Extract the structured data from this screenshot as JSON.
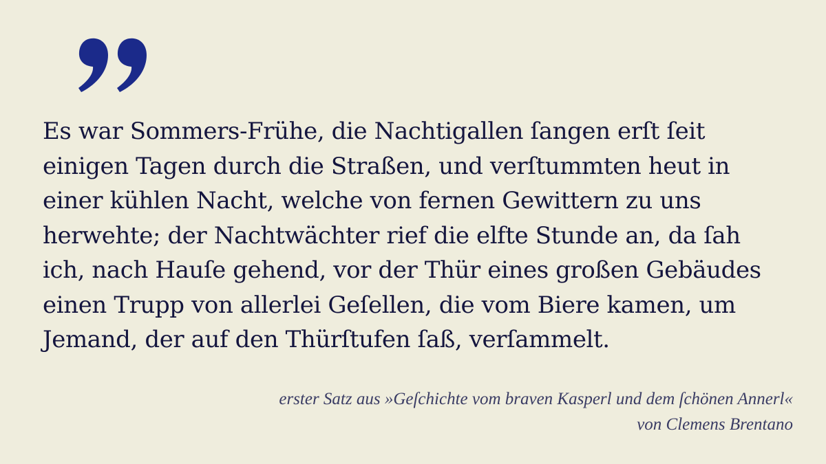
{
  "quote": {
    "lines": [
      "Es war Sommers-Frühe, die Nachtigallen ſangen erſt ſeit",
      "einigen Tagen durch die Straßen, und verſtummten heut in",
      "einer kühlen Nacht, welche von fernen Gewittern zu uns",
      "herwehte; der Nachtwächter rief die elfte Stunde an, da ſah",
      "ich, nach Hauſe gehend, vor der Thür eines großen Gebäudes",
      "einen Trupp von allerlei Geſellen, die vom Biere kamen, um",
      "Jemand, der auf den Thürſtufen ſaß, verſammelt."
    ]
  },
  "attribution": {
    "line1": "erster Satz aus »Geſchichte vom braven Kasperl und dem ſchönen Annerl«",
    "line2": "von Clemens Brentano"
  },
  "colors": {
    "background": "#efeddd",
    "quote_mark": "#1b2a8a",
    "text": "#14153e",
    "attribution": "#3a3c64"
  },
  "icons": {
    "quote_mark": "closing-quotation-mark-icon"
  }
}
